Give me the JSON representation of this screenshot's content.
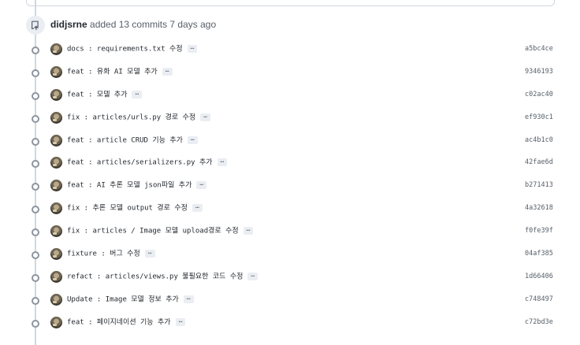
{
  "push": {
    "author": "didjsrne",
    "action_text": "added 13 commits 7 days ago",
    "icon": "repo-push-icon"
  },
  "commits": [
    {
      "message": "docs : requirements.txt 수정",
      "sha": "a5bc4ce"
    },
    {
      "message": "feat : 유화 AI 모델 추가",
      "sha": "9346193"
    },
    {
      "message": "feat : 모델 추가",
      "sha": "c02ac40"
    },
    {
      "message": "fix : articles/urls.py 경로 수정",
      "sha": "ef930c1"
    },
    {
      "message": "feat : article CRUD 기능 추가",
      "sha": "ac4b1c0"
    },
    {
      "message": "feat : articles/serializers.py 추가",
      "sha": "42fae6d"
    },
    {
      "message": "feat : AI 추론 모델 json파일 추가",
      "sha": "b271413"
    },
    {
      "message": "fix : 추론 모델 output 경로 수정",
      "sha": "4a32618"
    },
    {
      "message": "fix : articles / Image 모델 upload경로 수정",
      "sha": "f0fe39f"
    },
    {
      "message": "fixture : 버그 수정",
      "sha": "04af385"
    },
    {
      "message": "refact : articles/views.py 불필요한 코드 수정",
      "sha": "1d66406"
    },
    {
      "message": "Update : Image 모델 정보 추가",
      "sha": "c748497"
    },
    {
      "message": "feat : 페이지네이션 기능 추가",
      "sha": "c72bd3e"
    }
  ],
  "ellipsis_label": "…"
}
